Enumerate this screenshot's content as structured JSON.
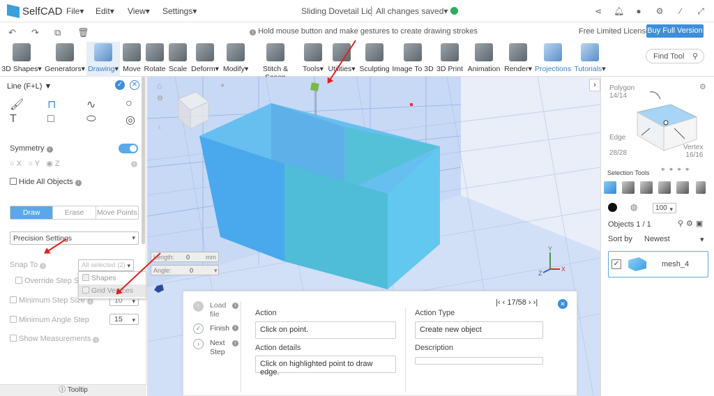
{
  "app": {
    "name": "SelfCAD",
    "doc_title": "Sliding Dovetail Lid",
    "save_status": "All changes saved"
  },
  "menus": [
    "File",
    "Edit",
    "View",
    "Settings"
  ],
  "hint": "Hold mouse button and make gestures to create drawing strokes",
  "license": {
    "text": "Free Limited License",
    "buy_label": "Buy Full Version"
  },
  "toolbar": {
    "tools": [
      "3D Shapes",
      "Generators",
      "Drawing",
      "Move",
      "Rotate",
      "Scale",
      "Deform",
      "Modify",
      "Stitch & Scoop",
      "Tools",
      "Utilities",
      "Sculpting",
      "Image To 3D",
      "3D Print",
      "Animation",
      "Render",
      "Projections",
      "Tutorials"
    ],
    "find_placeholder": "Find Tool"
  },
  "left_panel": {
    "title": "Line (F+L)",
    "symmetry": "Symmetry",
    "axes": [
      "X",
      "Y",
      "Z"
    ],
    "hide_all": "Hide All Objects",
    "modes": [
      "Draw",
      "Erase",
      "Move Points"
    ],
    "precision": "Precision Settings",
    "snap_to": "Snap To",
    "snap_value": "All selected (2)",
    "snap_options": [
      "Shapes",
      "Grid Vertices"
    ],
    "override_step": "Override Step Size",
    "min_step": "Minimum Step Size",
    "min_step_value": "10",
    "min_angle": "Minimum Angle Step",
    "min_angle_value": "15",
    "show_measurements": "Show Measurements",
    "length_label": "Length:",
    "length_value": "0",
    "length_unit": "mm",
    "angle_label": "Angle:",
    "angle_value": "0",
    "tooltip": "Tooltip"
  },
  "tutorial": {
    "steps": [
      "Load file",
      "Finish",
      "Next Step"
    ],
    "counter": "17/58",
    "action_label": "Action",
    "action_value": "Click on point.",
    "action_type_label": "Action Type",
    "action_type_value": "Create new object",
    "details_label": "Action details",
    "details_value": "Click on highlighted point to draw edge.",
    "description_label": "Description"
  },
  "right_panel": {
    "polygon": {
      "label": "Polygon",
      "count": "14/14"
    },
    "edge": {
      "label": "Edge",
      "count": "28/28"
    },
    "vertex": {
      "label": "Vertex",
      "count": "16/16"
    },
    "selection_tools": "Selection Tools",
    "opacity": "100",
    "objects_count": "Objects 1 / 1",
    "sort_by": "Sort by",
    "sort_value": "Newest",
    "object_name": "mesh_4"
  },
  "colors": {
    "accent": "#3e8ed8",
    "box": "#5bb4ec",
    "grid_plane": "#aacbf2",
    "arrow": "#e02020"
  }
}
